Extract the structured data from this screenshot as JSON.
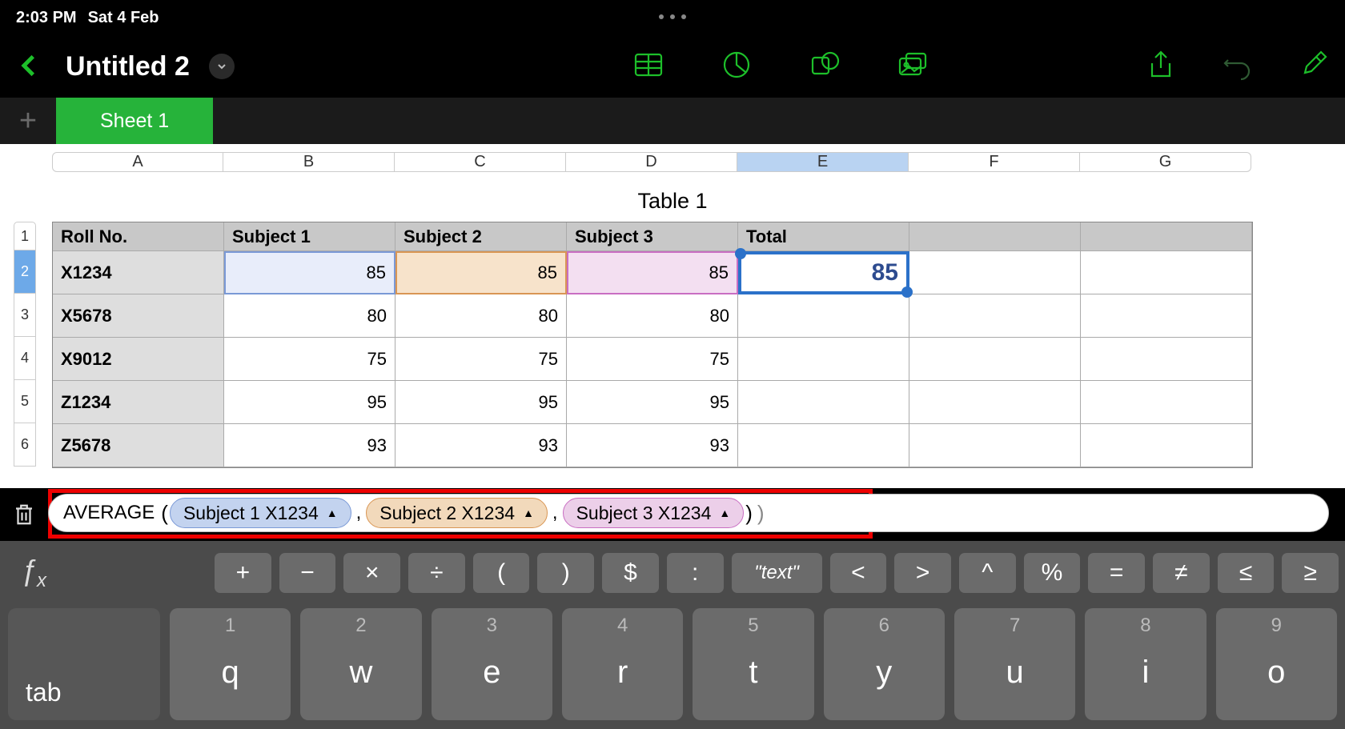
{
  "status": {
    "time": "2:03 PM",
    "date": "Sat 4 Feb"
  },
  "header": {
    "doc_title": "Untitled 2"
  },
  "tabs": {
    "add": "+",
    "sheet1": "Sheet 1"
  },
  "table": {
    "title": "Table 1",
    "cols": [
      "A",
      "B",
      "C",
      "D",
      "E",
      "F",
      "G"
    ],
    "rows": [
      "1",
      "2",
      "3",
      "4",
      "5",
      "6"
    ],
    "headers": {
      "roll": "Roll No.",
      "s1": "Subject 1",
      "s2": "Subject 2",
      "s3": "Subject 3",
      "total": "Total"
    },
    "data": [
      {
        "roll": "X1234",
        "s1": "85",
        "s2": "85",
        "s3": "85",
        "total": "85"
      },
      {
        "roll": "X5678",
        "s1": "80",
        "s2": "80",
        "s3": "80",
        "total": ""
      },
      {
        "roll": "X9012",
        "s1": "75",
        "s2": "75",
        "s3": "75",
        "total": ""
      },
      {
        "roll": "Z1234",
        "s1": "95",
        "s2": "95",
        "s3": "95",
        "total": ""
      },
      {
        "roll": "Z5678",
        "s1": "93",
        "s2": "93",
        "s3": "93",
        "total": ""
      }
    ]
  },
  "formula": {
    "fn": "AVERAGE",
    "token1": "Subject 1 X1234",
    "token2": "Subject 2 X1234",
    "token3": "Subject 3 X1234",
    "tri": "▲",
    "lparen": "(",
    "rparen": ")",
    "comma": ","
  },
  "kbd": {
    "fx": "ƒ",
    "fxsub": "x",
    "ops": [
      "+",
      "−",
      "×",
      "÷",
      "(",
      ")",
      "$",
      ":",
      "\"text\"",
      "<",
      ">",
      "^",
      "%",
      "=",
      "≠",
      "≤",
      "≥"
    ],
    "tab": "tab",
    "keys": [
      {
        "s": "1",
        "m": "q"
      },
      {
        "s": "2",
        "m": "w"
      },
      {
        "s": "3",
        "m": "e"
      },
      {
        "s": "4",
        "m": "r"
      },
      {
        "s": "5",
        "m": "t"
      },
      {
        "s": "6",
        "m": "y"
      },
      {
        "s": "7",
        "m": "u"
      },
      {
        "s": "8",
        "m": "i"
      },
      {
        "s": "9",
        "m": "o"
      }
    ]
  }
}
